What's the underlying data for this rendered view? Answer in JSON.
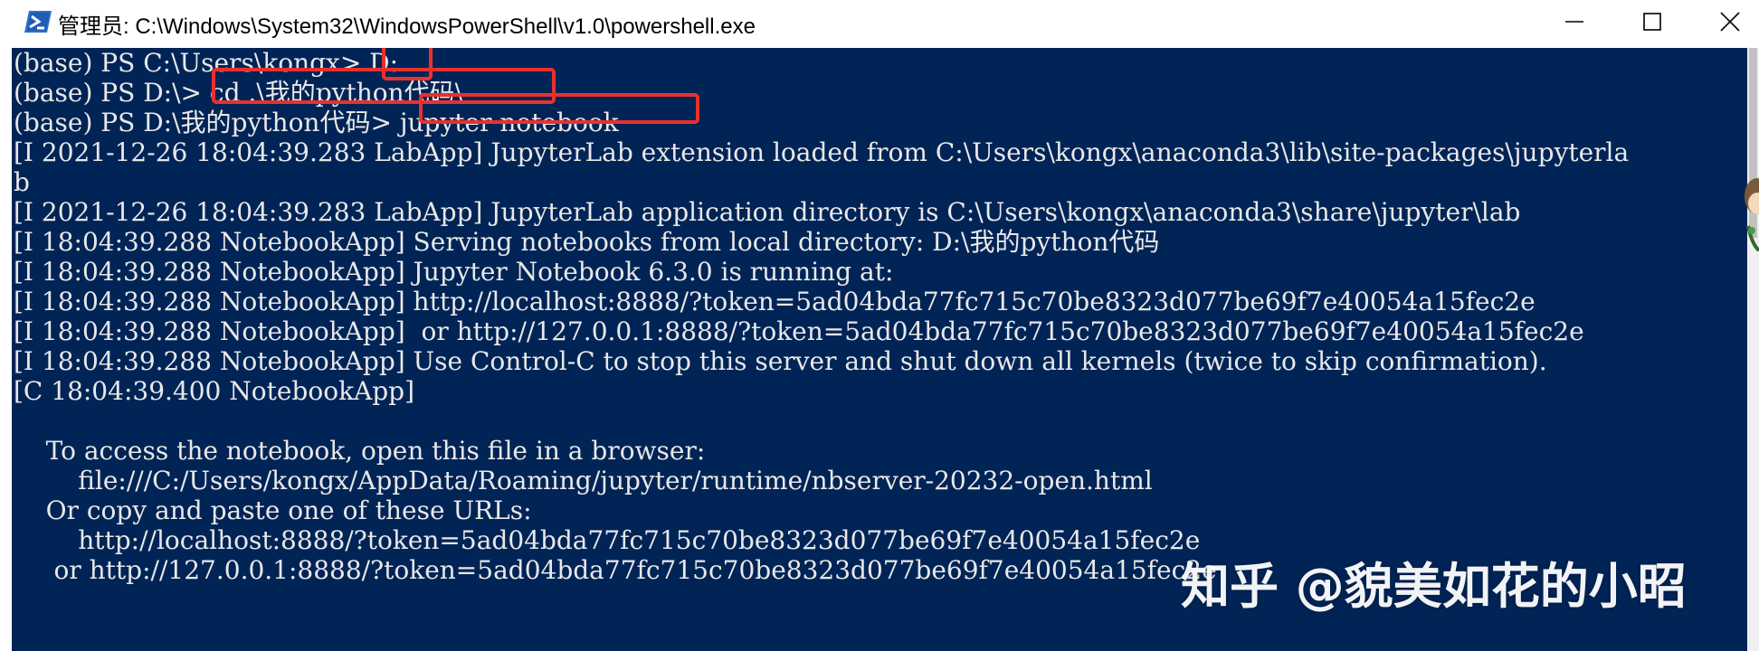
{
  "window": {
    "title": "管理员: C:\\Windows\\System32\\WindowsPowerShell\\v1.0\\powershell.exe",
    "icon": "powershell-icon",
    "controls": [
      "minimize-icon",
      "maximize-icon",
      "close-icon"
    ]
  },
  "colors": {
    "console_bg": "#012456",
    "console_text": "#e8e8e8",
    "highlight_box": "#e8312d",
    "titlebar_bg": "#ffffff"
  },
  "console": {
    "lines": [
      "(base) PS C:\\Users\\kongx> D:",
      "(base) PS D:\\> cd .\\我的python代码\\",
      "(base) PS D:\\我的python代码> jupyter notebook",
      "[I 2021-12-26 18:04:39.283 LabApp] JupyterLab extension loaded from C:\\Users\\kongx\\anaconda3\\lib\\site-packages\\jupyterla",
      "b",
      "[I 2021-12-26 18:04:39.283 LabApp] JupyterLab application directory is C:\\Users\\kongx\\anaconda3\\share\\jupyter\\lab",
      "[I 18:04:39.288 NotebookApp] Serving notebooks from local directory: D:\\我的python代码",
      "[I 18:04:39.288 NotebookApp] Jupyter Notebook 6.3.0 is running at:",
      "[I 18:04:39.288 NotebookApp] http://localhost:8888/?token=5ad04bda77fc715c70be8323d077be69f7e40054a15fec2e",
      "[I 18:04:39.288 NotebookApp]  or http://127.0.0.1:8888/?token=5ad04bda77fc715c70be8323d077be69f7e40054a15fec2e",
      "[I 18:04:39.288 NotebookApp] Use Control-C to stop this server and shut down all kernels (twice to skip confirmation).",
      "[C 18:04:39.400 NotebookApp]",
      "",
      "    To access the notebook, open this file in a browser:",
      "        file:///C:/Users/kongx/AppData/Roaming/jupyter/runtime/nbserver-20232-open.html",
      "    Or copy and paste one of these URLs:",
      "        http://localhost:8888/?token=5ad04bda77fc715c70be8323d077be69f7e40054a15fec2e",
      "     or http://127.0.0.1:8888/?token=5ad04bda77fc715c70be8323d077be69f7e40054a15fec2e",
      "",
      ""
    ]
  },
  "watermark": {
    "text": "知乎 @貌美如花的小昭"
  }
}
